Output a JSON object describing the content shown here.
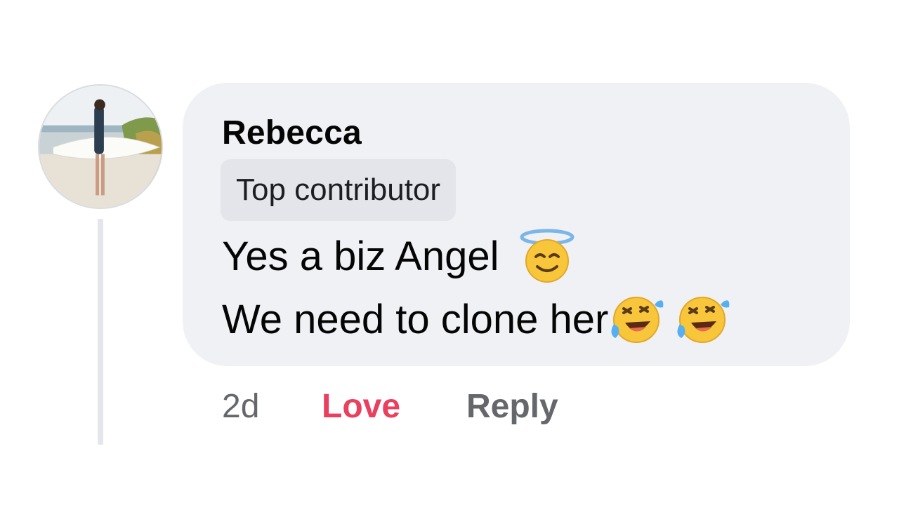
{
  "comment": {
    "author": "Rebecca",
    "badge": "Top contributor",
    "lines": [
      "Yes a biz Angel",
      "We need to clone her"
    ],
    "emojis": [
      "smiling-face-with-halo-icon",
      "rolling-on-the-floor-laughing-icon",
      "rolling-on-the-floor-laughing-icon"
    ]
  },
  "actions": {
    "time": "2d",
    "reaction": "Love",
    "reply": "Reply"
  },
  "colors": {
    "bubble": "#f0f1f5",
    "badge": "#e4e5ea",
    "love": "#e8405e",
    "secondary_text": "#65676b"
  }
}
